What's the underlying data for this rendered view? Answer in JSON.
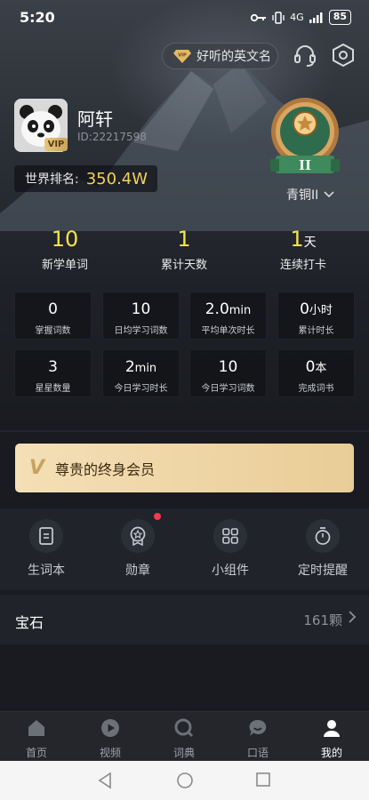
{
  "status": {
    "time": "5:20",
    "signal": "4G",
    "battery": "85"
  },
  "header": {
    "vip_pill_label": "好听的英文名"
  },
  "profile": {
    "name": "阿轩",
    "id": "ID:22217598",
    "vip_badge": "VIP",
    "rank_label": "世界排名:",
    "rank_value": "350.4W",
    "medal_level": "II",
    "medal_name": "青铜II"
  },
  "main_stats": [
    {
      "value": "10",
      "unit": "",
      "label": "新学单词"
    },
    {
      "value": "1",
      "unit": "",
      "label": "累计天数"
    },
    {
      "value": "1",
      "unit": "天",
      "label": "连续打卡"
    }
  ],
  "grid_stats": [
    {
      "value": "0",
      "unit": "",
      "label": "掌握词数"
    },
    {
      "value": "10",
      "unit": "",
      "label": "日均学习词数"
    },
    {
      "value": "2.0",
      "unit": "min",
      "label": "平均单次时长"
    },
    {
      "value": "0",
      "unit": "小时",
      "label": "累计时长"
    },
    {
      "value": "3",
      "unit": "",
      "label": "星星数量"
    },
    {
      "value": "2",
      "unit": "min",
      "label": "今日学习时长"
    },
    {
      "value": "10",
      "unit": "",
      "label": "今日学习词数"
    },
    {
      "value": "0",
      "unit": "本",
      "label": "完成词书"
    }
  ],
  "vip_banner": {
    "mark": "V",
    "text": "尊贵的终身会员"
  },
  "menu": [
    {
      "label": "生词本",
      "icon": "notebook-icon"
    },
    {
      "label": "勋章",
      "icon": "medal-icon"
    },
    {
      "label": "小组件",
      "icon": "widgets-icon"
    },
    {
      "label": "定时提醒",
      "icon": "timer-icon"
    }
  ],
  "gems": {
    "title": "宝石",
    "count": "161颗"
  },
  "tabs": [
    {
      "label": "首页",
      "icon": "home-icon"
    },
    {
      "label": "视频",
      "icon": "video-icon"
    },
    {
      "label": "词典",
      "icon": "dictionary-icon"
    },
    {
      "label": "口语",
      "icon": "speaking-icon"
    },
    {
      "label": "我的",
      "icon": "profile-icon"
    }
  ],
  "colors": {
    "accent_yellow": "#f7e24a",
    "rank_gold": "#f3d05c",
    "badge_red": "#f43a4e",
    "vip_gold": "#e9cd97"
  }
}
